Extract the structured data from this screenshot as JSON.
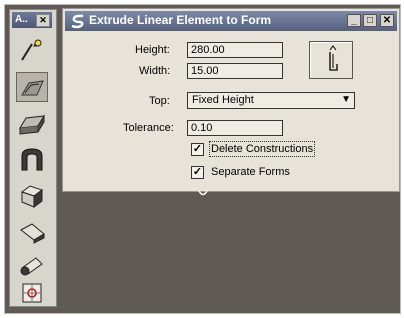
{
  "palette": {
    "title": "A..",
    "close_label": "✕",
    "tools": [
      {
        "name": "tool-element-selection"
      },
      {
        "name": "tool-extrude-linear-to-form"
      },
      {
        "name": "tool-slab"
      },
      {
        "name": "tool-arch"
      },
      {
        "name": "tool-box"
      },
      {
        "name": "tool-wedge"
      },
      {
        "name": "tool-cylinder"
      },
      {
        "name": "tool-settings"
      }
    ]
  },
  "dialog": {
    "title": "Extrude Linear Element to Form",
    "window_buttons": {
      "minimize": "_",
      "maximize": "□",
      "close": "✕"
    },
    "height": {
      "label": "Height:",
      "value": "280.00"
    },
    "width": {
      "label": "Width:",
      "value": "15.00"
    },
    "top": {
      "label": "Top:",
      "value": "Fixed Height",
      "arrow": "▼"
    },
    "tolerance": {
      "label": "Tolerance:",
      "value": "0.10"
    },
    "delete_constructions": {
      "label": "Delete Constructions",
      "checked": true,
      "check": "✓"
    },
    "separate_forms": {
      "label": "Separate Forms",
      "checked": true,
      "check": "✓"
    }
  }
}
